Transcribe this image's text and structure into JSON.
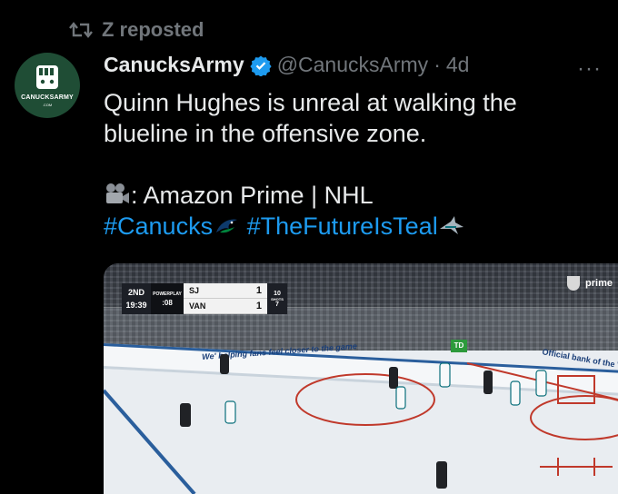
{
  "repost": {
    "label": "Z reposted",
    "icon": "repost-icon"
  },
  "avatar": {
    "brand": "CANUCKSARMY",
    "brand_sub": ".COM",
    "color": "#1f4d35"
  },
  "author": {
    "name": "CanucksArmy",
    "handle": "@CanucksArmy",
    "separator": "·",
    "time": "4d",
    "verified_color": "#1d9bf0"
  },
  "more_label": "···",
  "tweet": {
    "line1": "Quinn Hughes is unreal at walking the blueline in the offensive zone.",
    "credit": ": Amazon Prime | NHL",
    "hashtag1": "#Canucks",
    "hashtag2": "#TheFutureIsTeal",
    "hashtag_color": "#1d9bf0"
  },
  "media": {
    "scorebug": {
      "period": "2ND",
      "clock": "19:39",
      "powerplay_label": "POWERPLAY",
      "powerplay_time": ":08",
      "team1": "SJ",
      "score1": "1",
      "team2": "VAN",
      "score2": "1",
      "shots_label": "SHOTS",
      "shots1": "10",
      "shots2": "7"
    },
    "broadcaster": "prime",
    "ad_left": "We'  helping fans feel closer to the game",
    "ad_right": "Official bank of the V",
    "td_label": "TD"
  }
}
